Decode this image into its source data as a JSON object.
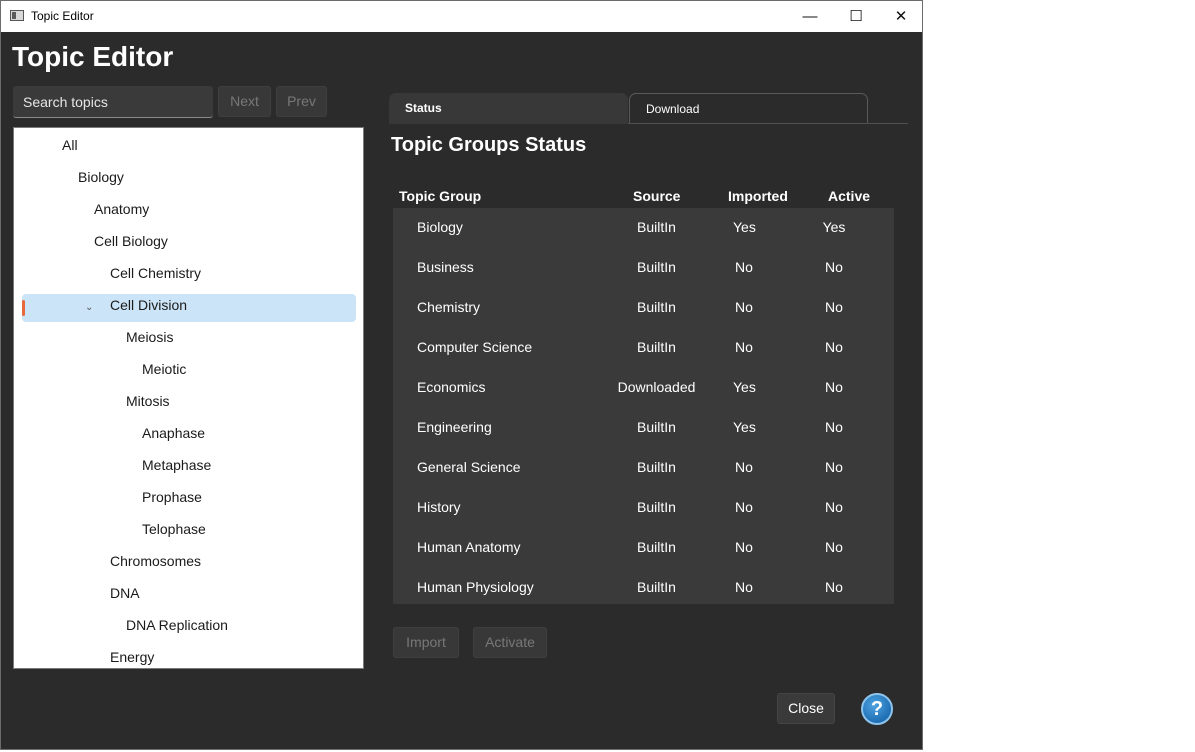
{
  "window": {
    "title": "Topic Editor",
    "minimize": "—",
    "maximize": "☐",
    "close": "✕"
  },
  "page_title": "Topic Editor",
  "search": {
    "placeholder": "Search topics",
    "value": ""
  },
  "nav": {
    "next": "Next",
    "prev": "Prev"
  },
  "tree": {
    "chevron": "⌄",
    "items": [
      {
        "label": "All"
      },
      {
        "label": "Biology"
      },
      {
        "label": "Anatomy"
      },
      {
        "label": "Cell Biology"
      },
      {
        "label": "Cell Chemistry"
      },
      {
        "label": "Cell Division",
        "selected": true,
        "expanded": true
      },
      {
        "label": "Meiosis"
      },
      {
        "label": "Meiotic"
      },
      {
        "label": "Mitosis"
      },
      {
        "label": "Anaphase"
      },
      {
        "label": "Metaphase"
      },
      {
        "label": "Prophase"
      },
      {
        "label": "Telophase"
      },
      {
        "label": "Chromosomes"
      },
      {
        "label": "DNA"
      },
      {
        "label": "DNA Replication"
      },
      {
        "label": "Energy"
      }
    ]
  },
  "tabs": [
    {
      "label": "Status",
      "active": true
    },
    {
      "label": "Download",
      "active": false
    }
  ],
  "status": {
    "title": "Topic Groups Status",
    "columns": [
      "Topic Group",
      "Source",
      "Imported",
      "Active"
    ],
    "rows": [
      {
        "group": "Biology",
        "source": "BuiltIn",
        "imported": "Yes",
        "active": "Yes"
      },
      {
        "group": "Business",
        "source": "BuiltIn",
        "imported": "No",
        "active": "No"
      },
      {
        "group": "Chemistry",
        "source": "BuiltIn",
        "imported": "No",
        "active": "No"
      },
      {
        "group": "Computer Science",
        "source": "BuiltIn",
        "imported": "No",
        "active": "No"
      },
      {
        "group": "Economics",
        "source": "Downloaded",
        "imported": "Yes",
        "active": "No"
      },
      {
        "group": "Engineering",
        "source": "BuiltIn",
        "imported": "Yes",
        "active": "No"
      },
      {
        "group": "General Science",
        "source": "BuiltIn",
        "imported": "No",
        "active": "No"
      },
      {
        "group": "History",
        "source": "BuiltIn",
        "imported": "No",
        "active": "No"
      },
      {
        "group": "Human Anatomy",
        "source": "BuiltIn",
        "imported": "No",
        "active": "No"
      },
      {
        "group": "Human Physiology",
        "source": "BuiltIn",
        "imported": "No",
        "active": "No"
      }
    ],
    "import_label": "Import",
    "activate_label": "Activate"
  },
  "footer": {
    "close_label": "Close",
    "help_label": "?"
  },
  "colors": {
    "background": "#2b2b2b",
    "panel": "#3a3a3a",
    "selection": "#cce4f7",
    "selection_marker": "#e8693b",
    "help_blue": "#1f6fb4"
  }
}
